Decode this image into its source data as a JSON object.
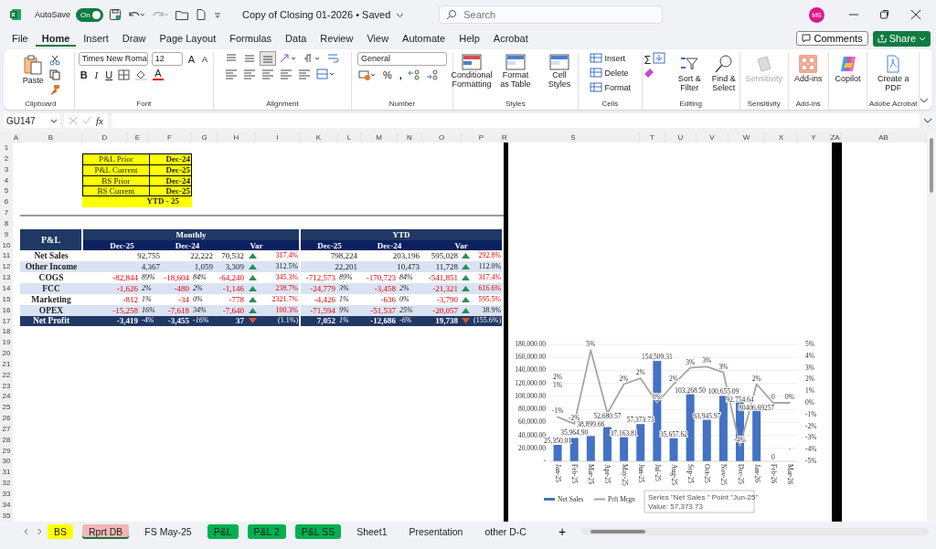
{
  "title_bar": {
    "autosave_label": "AutoSave",
    "autosave": {
      "label": "On",
      "on": true
    },
    "document_title": "Copy of Closing 01-2026 • Saved",
    "search": {
      "placeholder": "Search"
    },
    "avatar": "MS"
  },
  "menu_tabs": [
    {
      "label": "File",
      "selected": false
    },
    {
      "label": "Home",
      "selected": true
    },
    {
      "label": "Insert",
      "selected": false
    },
    {
      "label": "Draw",
      "selected": false
    },
    {
      "label": "Page Layout",
      "selected": false
    },
    {
      "label": "Formulas",
      "selected": false
    },
    {
      "label": "Data",
      "selected": false
    },
    {
      "label": "Review",
      "selected": false
    },
    {
      "label": "View",
      "selected": false
    },
    {
      "label": "Automate",
      "selected": false
    },
    {
      "label": "Help",
      "selected": false
    },
    {
      "label": "Acrobat",
      "selected": false
    }
  ],
  "comments_button": "Comments",
  "share_button": "Share",
  "ribbon": {
    "clipboard": {
      "paste": "Paste",
      "label": "Clipboard"
    },
    "font": {
      "family": "Times New Roma",
      "size": "12",
      "grow": "A",
      "shrink": "A",
      "bold": "B",
      "italic": "I",
      "underline": "U",
      "text_color_letter": "A",
      "label": "Font"
    },
    "alignment": {
      "label": "Alignment"
    },
    "number": {
      "format": "General",
      "percent": "%",
      "comma": ",",
      "label": "Number"
    },
    "styles": {
      "buttons": [
        "Conditional Formatting",
        "Format as Table",
        "Cell Styles"
      ],
      "label": "Styles"
    },
    "cells": {
      "buttons": [
        "Insert",
        "Delete",
        "Format"
      ],
      "label": "Cells"
    },
    "editing": {
      "sigma": "Σ",
      "buttons": [
        "Sort & Filter",
        "Find & Select"
      ],
      "label": "Editing"
    },
    "sensitivity": {
      "button": "Sensitivity",
      "disabled": true,
      "label": "Sensitivity"
    },
    "addins": {
      "button": "Add-ins",
      "label": "Add-ins"
    },
    "copilot": {
      "button": "Copilot"
    },
    "acrobat": {
      "button": "Create a PDF",
      "label": "Adobe Acrobat"
    }
  },
  "formula_bar": {
    "name_box": "GU147",
    "fx": "fx"
  },
  "columns": [
    "A",
    "B",
    "D",
    "E",
    "F",
    "G",
    "H",
    "I",
    "K",
    "L",
    "M",
    "N",
    "O",
    "P",
    "R",
    "S",
    "T",
    "U",
    "V",
    "W",
    "X",
    "Y",
    "ZA",
    "AB"
  ],
  "row_numbers": [
    "1",
    "2",
    "3",
    "4",
    "5",
    "6",
    "7",
    "8",
    "9",
    "10",
    "11",
    "12",
    "13",
    "14",
    "15",
    "16",
    "17",
    "18",
    "19",
    "20",
    "21",
    "22",
    "23",
    "24",
    "25",
    "26",
    "27",
    "28",
    "29",
    "30",
    "31",
    "32",
    "33",
    "34",
    "35"
  ],
  "period_table": [
    {
      "label": "P&L Prior",
      "value": "Dec-24"
    },
    {
      "label": "P&L Current",
      "value": "Dec-25"
    },
    {
      "label": "BS Prior",
      "value": "Dec-24"
    },
    {
      "label": "BS Current",
      "value": "Dec-25"
    }
  ],
  "period_note": "YTD - 25",
  "pl_table": {
    "corner": "P&L",
    "groups": [
      "Monthly",
      "YTD"
    ],
    "subheads": [
      "Dec-25",
      "Dec-24",
      "Var",
      "Dec-25",
      "Dec-24",
      "Var"
    ],
    "rows": [
      {
        "label": "Net Sales",
        "total": false,
        "cells": [
          {
            "text": "92,755",
            "negative": false
          },
          {
            "text": "22,222",
            "negative": false
          },
          {
            "text": "70,532",
            "negative": false,
            "increase": true,
            "pct": "317.4%",
            "pct_red": true
          },
          {
            "text": "798,224",
            "negative": false
          },
          {
            "text": "203,196",
            "negative": false
          },
          {
            "text": "595,028",
            "negative": false,
            "increase": true,
            "pct": "292.8%",
            "pct_red": true
          }
        ]
      },
      {
        "label": "Other Income",
        "total": false,
        "cells": [
          {
            "text": "4,367",
            "negative": false
          },
          {
            "text": "1,059",
            "negative": false
          },
          {
            "text": "3,309",
            "negative": false,
            "increase": true,
            "pct": "312.5%",
            "pct_red": false
          },
          {
            "text": "22,201",
            "negative": false
          },
          {
            "text": "10,473",
            "negative": false
          },
          {
            "text": "11,728",
            "negative": false,
            "increase": true,
            "pct": "112.0%",
            "pct_red": false
          }
        ]
      },
      {
        "label": "COGS",
        "total": false,
        "cells": [
          {
            "text": "-82,844",
            "negative": true,
            "share": "89%"
          },
          {
            "text": "-18,604",
            "negative": true,
            "share": "84%"
          },
          {
            "text": "-64,240",
            "negative": true,
            "increase": true,
            "pct": "345.3%",
            "pct_red": true
          },
          {
            "text": "-712,573",
            "negative": true,
            "share": "89%"
          },
          {
            "text": "-170,723",
            "negative": true,
            "share": "84%"
          },
          {
            "text": "-541,851",
            "negative": true,
            "increase": true,
            "pct": "317.4%",
            "pct_red": true
          }
        ]
      },
      {
        "label": "FCC",
        "total": false,
        "cells": [
          {
            "text": "-1,626",
            "negative": true,
            "share": "2%"
          },
          {
            "text": "-480",
            "negative": true,
            "share": "2%"
          },
          {
            "text": "-1,146",
            "negative": true,
            "increase": true,
            "pct": "238.7%",
            "pct_red": true
          },
          {
            "text": "-24,779",
            "negative": true,
            "share": "3%"
          },
          {
            "text": "-3,458",
            "negative": true,
            "share": "2%"
          },
          {
            "text": "-21,321",
            "negative": true,
            "increase": true,
            "pct": "616.6%",
            "pct_red": true
          }
        ]
      },
      {
        "label": "Marketing",
        "total": false,
        "cells": [
          {
            "text": "-812",
            "negative": true,
            "share": "1%"
          },
          {
            "text": "-34",
            "negative": true,
            "share": "0%"
          },
          {
            "text": "-778",
            "negative": true,
            "increase": true,
            "pct": "2321.7%",
            "pct_red": true
          },
          {
            "text": "-4,426",
            "negative": true,
            "share": "1%"
          },
          {
            "text": "-636",
            "negative": true,
            "share": "0%"
          },
          {
            "text": "-3,790",
            "negative": true,
            "increase": true,
            "pct": "595.5%",
            "pct_red": true
          }
        ]
      },
      {
        "label": "OPEX",
        "total": false,
        "cells": [
          {
            "text": "-15,258",
            "negative": true,
            "share": "16%"
          },
          {
            "text": "-7,618",
            "negative": true,
            "share": "34%"
          },
          {
            "text": "-7,640",
            "negative": true,
            "increase": true,
            "pct": "100.3%",
            "pct_red": true
          },
          {
            "text": "-71,594",
            "negative": true,
            "share": "9%"
          },
          {
            "text": "-51,537",
            "negative": true,
            "share": "25%"
          },
          {
            "text": "-20,057",
            "negative": true,
            "increase": true,
            "pct": "38.9%",
            "pct_red": false
          }
        ]
      },
      {
        "label": "Net Profit",
        "total": true,
        "cells": [
          {
            "text": "-3,419",
            "negative": false,
            "share": "-4%"
          },
          {
            "text": "-3,455",
            "negative": false,
            "share": "-16%"
          },
          {
            "text": "37",
            "negative": false,
            "increase": false,
            "pct": "(1.1%)",
            "pct_red": false
          },
          {
            "text": "7,052",
            "negative": false,
            "share": "1%"
          },
          {
            "text": "-12,686",
            "negative": false,
            "share": "-6%"
          },
          {
            "text": "19,738",
            "negative": false,
            "increase": false,
            "pct": "(155.6%)",
            "pct_red": false
          }
        ]
      }
    ]
  },
  "chart_data": {
    "type": "bar",
    "categories": [
      "Jan-25",
      "Feb-25",
      "Mar-25",
      "Apr-25",
      "May-25",
      "Jun-25",
      "Jul-25",
      "Aug-25",
      "Sep-25",
      "Oct-25",
      "Nov-25",
      "Dec-25",
      "Jan-26",
      "Feb-26",
      "Mar-26"
    ],
    "series": [
      {
        "name": "Net Sales",
        "color": "#4472c4",
        "values": [
          25350.01,
          35964.9,
          38899.66,
          52680.57,
          37163.81,
          57373.73,
          154509.31,
          35657.62,
          103268.5,
          63945.97,
          100655.09,
          92754.64,
          80406.69257,
          0,
          null
        ],
        "value_labels": [
          "25,350.01",
          "35,964.90",
          "38,899.66",
          "52,680.57",
          "37,163.81",
          "57,373.73",
          "154,509.31",
          "35,657.62",
          "103,268.50",
          "63,945.97",
          "100,655.09",
          "92,754.64",
          "80406.69257",
          "0",
          "-"
        ]
      },
      {
        "name": "Prft Mrgn",
        "color": "#a5a5a5",
        "type": "line",
        "axis": "y2",
        "values": [
          -1.2,
          -1.8,
          4.5,
          -0.9,
          1.6,
          2.1,
          0,
          1.6,
          3,
          3.1,
          2.6,
          -3.7,
          1.6,
          0,
          0
        ],
        "value_labels": [
          "-1%",
          "-2%",
          "5%",
          null,
          "2%",
          "2%",
          "0%",
          "2%",
          "3%",
          "3%",
          "3%",
          "-4%",
          "2%",
          "0",
          "0%"
        ]
      }
    ],
    "grid": true,
    "legend": true,
    "annotations": [
      "2%",
      "1%"
    ],
    "ylim": [
      0,
      180000
    ],
    "yticks": [
      {
        "value": 0,
        "label": "-"
      },
      {
        "value": 20000,
        "label": "20,000.00"
      },
      {
        "value": 40000,
        "label": "40,000.00"
      },
      {
        "value": 60000,
        "label": "60,000.00"
      },
      {
        "value": 80000,
        "label": "80,000.00"
      },
      {
        "value": 100000,
        "label": "100,000.00"
      },
      {
        "value": 120000,
        "label": "120,000.00"
      },
      {
        "value": 140000,
        "label": "140,000.00"
      },
      {
        "value": 160000,
        "label": "160,000.00"
      },
      {
        "value": 180000,
        "label": "180,000.00"
      }
    ],
    "y2lim": [
      -5,
      5
    ],
    "y2ticks": [
      {
        "value": -5,
        "label": "-5%"
      },
      {
        "value": -4,
        "label": "-4%"
      },
      {
        "value": -3,
        "label": "-3%"
      },
      {
        "value": -2,
        "label": "-2%"
      },
      {
        "value": -1,
        "label": "-1%"
      },
      {
        "value": 0,
        "label": "0%"
      },
      {
        "value": 1,
        "label": "1%"
      },
      {
        "value": 2,
        "label": "2%"
      },
      {
        "value": 3,
        "label": "3%"
      },
      {
        "value": 4,
        "label": "4%"
      },
      {
        "value": 5,
        "label": "5%"
      }
    ]
  },
  "chart_tooltip": [
    "Series \"Net Sales \" Point \"Jun-25\"",
    "Value:  57,373.73"
  ],
  "sheet_tabs": [
    {
      "label": "BS",
      "color": "#ffff00",
      "selected": false
    },
    {
      "label": "Rprt DB",
      "color": "#f4b6b6",
      "selected": true
    },
    {
      "label": "FS May-25",
      "selected": false
    },
    {
      "label": "P&L",
      "color": "#00b050",
      "selected": false
    },
    {
      "label": "P&L 2",
      "color": "#00b050",
      "selected": false
    },
    {
      "label": "P&L SS",
      "color": "#00b050",
      "selected": false
    },
    {
      "label": "Sheet1",
      "selected": false
    },
    {
      "label": "Presentation",
      "selected": false
    },
    {
      "label": "other D-C",
      "selected": false
    }
  ],
  "add_sheet": "+"
}
